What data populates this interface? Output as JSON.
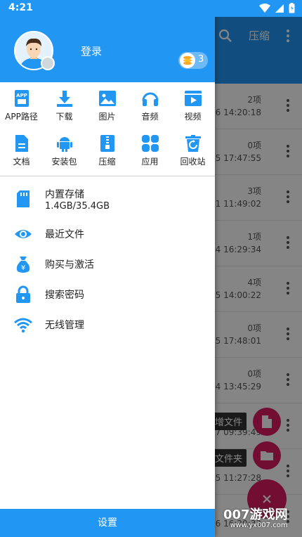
{
  "status": {
    "time": "4:21"
  },
  "background": {
    "toolbar_title": "压缩",
    "rows": [
      {
        "count": "2项",
        "date": "/16 14:20:18"
      },
      {
        "count": "0项",
        "date": "/15 17:47:55"
      },
      {
        "count": "3项",
        "date": "/21 11:49:02"
      },
      {
        "count": "1项",
        "date": "/14 16:29:34"
      },
      {
        "count": "4项",
        "date": "/15 14:00:22"
      },
      {
        "count": "0项",
        "date": "/15 17:48:01"
      },
      {
        "count": "0项",
        "date": "/14 13:45:29"
      },
      {
        "count": "",
        "date": "/17 09:39:49"
      },
      {
        "count": "",
        "date": "/25 11:27:28"
      },
      {
        "count": "",
        "date": "/16 16:20:33"
      }
    ],
    "fab_new_file": "增文件",
    "fab_new_folder": "文件夹"
  },
  "drawer": {
    "login": "登录",
    "coin_count": "3",
    "grid": [
      {
        "label": "APP路径",
        "icon": "app-path-icon"
      },
      {
        "label": "下载",
        "icon": "download-icon"
      },
      {
        "label": "图片",
        "icon": "image-icon"
      },
      {
        "label": "音频",
        "icon": "headphones-icon"
      },
      {
        "label": "视频",
        "icon": "video-icon"
      },
      {
        "label": "文档",
        "icon": "document-icon"
      },
      {
        "label": "安装包",
        "icon": "android-icon"
      },
      {
        "label": "压缩",
        "icon": "zip-icon"
      },
      {
        "label": "应用",
        "icon": "apps-icon"
      },
      {
        "label": "回收站",
        "icon": "recycle-bin-icon"
      }
    ],
    "storage": {
      "title": "内置存储",
      "usage": "1.4GB/35.4GB"
    },
    "menu": [
      {
        "label": "最近文件",
        "icon": "eye-icon"
      },
      {
        "label": "购买与激活",
        "icon": "money-bag-icon"
      },
      {
        "label": "搜索密码",
        "icon": "lock-icon"
      },
      {
        "label": "无线管理",
        "icon": "wifi-icon"
      }
    ],
    "settings": "设置"
  },
  "watermark": {
    "main": "007游戏网",
    "sub": "www.yx007.com"
  },
  "colors": {
    "primary": "#2196f3",
    "accent": "#d81b60"
  }
}
